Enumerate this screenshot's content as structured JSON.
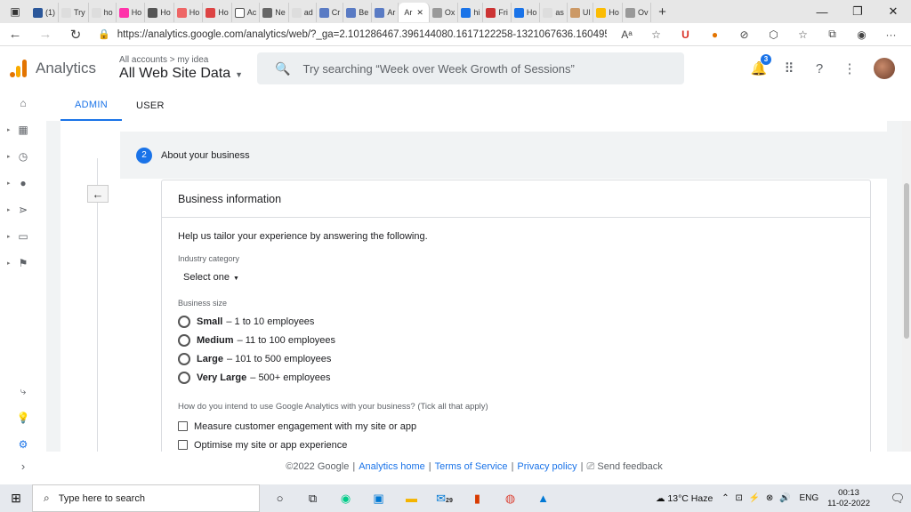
{
  "browser": {
    "tabs": [
      {
        "label": "(1)"
      },
      {
        "label": "Try"
      },
      {
        "label": "ho"
      },
      {
        "label": "Ho"
      },
      {
        "label": "Ho"
      },
      {
        "label": "Ho"
      },
      {
        "label": "Ho"
      },
      {
        "label": "Ac"
      },
      {
        "label": "Ne"
      },
      {
        "label": "ad"
      },
      {
        "label": "Cr"
      },
      {
        "label": "Be"
      },
      {
        "label": "Ar"
      }
    ],
    "active_tab": {
      "label": "Ar",
      "close": "✕"
    },
    "tabs_after": [
      {
        "label": "Ox"
      },
      {
        "label": "hi"
      },
      {
        "label": "Fri"
      },
      {
        "label": "Ho"
      },
      {
        "label": "as"
      },
      {
        "label": "Ul"
      },
      {
        "label": "Ho"
      },
      {
        "label": "Ov"
      }
    ],
    "new_tab": "+",
    "url": "https://analytics.google.com/analytics/web/?_ga=2.101286467.396144080.1617122258-1321067636.1604955771#/..."
  },
  "ga": {
    "app_name": "Analytics",
    "breadcrumb": "All accounts > my idea",
    "property": "All Web Site Data",
    "search_placeholder": "Try searching “Week over Week Growth of Sessions”",
    "notification_count": "3"
  },
  "subtabs": {
    "admin": "ADMIN",
    "user": "USER"
  },
  "step": {
    "number": "2",
    "title": "About your business"
  },
  "card": {
    "title": "Business information",
    "intro": "Help us tailor your experience by answering the following.",
    "industry_label": "Industry category",
    "industry_value": "Select one",
    "size_label": "Business size",
    "sizes": [
      {
        "name": "Small",
        "desc": "– 1 to 10 employees"
      },
      {
        "name": "Medium",
        "desc": "– 11 to 100 employees"
      },
      {
        "name": "Large",
        "desc": "– 101 to 500 employees"
      },
      {
        "name": "Very Large",
        "desc": "– 500+ employees"
      }
    ],
    "usage_question": "How do you intend to use Google Analytics with your business? (Tick all that apply)",
    "usage_options": [
      {
        "label": "Measure customer engagement with my site or app"
      },
      {
        "label": "Optimise my site or app experience"
      }
    ]
  },
  "footer": {
    "copyright": "©2022 Google",
    "home": "Analytics home",
    "terms": "Terms of Service",
    "privacy": "Privacy policy",
    "feedback": "Send feedback"
  },
  "taskbar": {
    "search_placeholder": "Type here to search",
    "mail_badge": "29",
    "weather": "13°C  Haze",
    "lang": "ENG",
    "time": "00:13",
    "date": "11-02-2022"
  }
}
